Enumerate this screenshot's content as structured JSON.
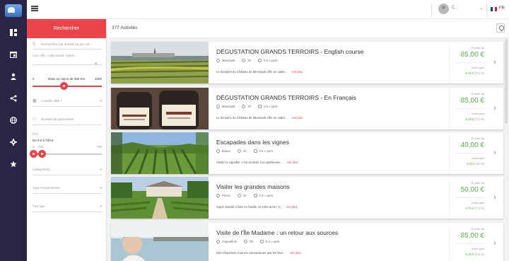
{
  "sidebar_rail": {
    "items": [
      "grid-icon",
      "calendar-icon",
      "user-icon",
      "share-icon",
      "globe-icon",
      "gear-icon",
      "star-icon"
    ],
    "active_index": 4
  },
  "topbar": {
    "user_name": "C.",
    "lang": "FR",
    "flag_colors": [
      "#1b3c8e",
      "#ffffff",
      "#d8202a"
    ]
  },
  "search": {
    "title": "Rechercher",
    "query_placeholder": "Recherchez par activité ou par ent...",
    "location_placeholder": "Lieu, ville, code postal, region...",
    "radius_min": "0",
    "radius_label": "Dans un rayon de 450 Km",
    "radius_max": "1000",
    "radius_fraction": 0.45,
    "date_placeholder": "A quelle date ?",
    "participants_placeholder": "Nombre de participants",
    "price_label": "Prix",
    "price_range": "De 0 € à 700 €",
    "price_min": "0",
    "price_mid": "700",
    "price_max": "700",
    "price_fraction_low": 0.0,
    "price_fraction_high": 0.11,
    "category_label": "Catégorie(s)",
    "experience_label": "Type d'expériences",
    "sort_label": "Trier par"
  },
  "results": {
    "count_label": "377 Activités",
    "items": [
      {
        "title": "DÉGUSTATION GRANDS TERROIRS - English course",
        "city": "Meursault",
        "duration": "2h",
        "people": "0 à ∞ pers.",
        "desc": "Le domaine du Château de Meursault offre un cadre...",
        "more": "voir plus",
        "from": "À partir de",
        "price": "85,00 €",
        "gain_label": "Votre gain",
        "gain": "6,38 €",
        "gain_pct": "(7,5 %)"
      },
      {
        "title": "DÉGUSTATION GRANDS TERROIRS - En Français",
        "city": "Meursault",
        "duration": "2h",
        "people": "0 à ∞ pers.",
        "desc": "Le domaine du Château de Meursault offre un cadre...",
        "more": "voir plus",
        "from": "À partir de",
        "price": "85,00 €",
        "gain_label": "Votre gain",
        "gain": "6,38 €",
        "gain_pct": "(7,5 %)"
      },
      {
        "title": "Escapades dans les vignes",
        "city": "Buxeu",
        "duration": "1h",
        "people": "0 à ∞ pers.",
        "desc": "Visitez le vignoble, c'est accéder à un patrimoine...",
        "more": "voir plus",
        "from": "À partir de",
        "price": "40,00 €",
        "gain_label": "Votre gain",
        "gain": "4,00 €",
        "gain_pct": "(10 %)"
      },
      {
        "title": "Visiter les grandes maisons",
        "city": "Prinze",
        "duration": "1h",
        "people": "0 à ∞ pers.",
        "desc": "Super activité à faire en famille ou entre amis ! V...",
        "more": "voir plus",
        "from": "À partir de",
        "price": "50,00 €",
        "gain_label": "Votre gain",
        "gain": "3,75 €",
        "gain_pct": "(7,5 %)"
      },
      {
        "title": "Visite de l'Île Madame : un retour aux sources",
        "city": "Angoulême",
        "duration": "3h",
        "people": "0 à ∞ pers.",
        "desc": "Des Charentes, tous les connaisseurs que les favo...",
        "more": "voir plus",
        "from": "À partir de",
        "price": "85,00 €",
        "gain_label": "Votre gain",
        "gain": "6,38 €",
        "gain_pct": "(7,5 %)"
      }
    ]
  },
  "colors": {
    "accent": "#e8444a",
    "price_green": "#56b24a",
    "rail": "#2a2545"
  }
}
